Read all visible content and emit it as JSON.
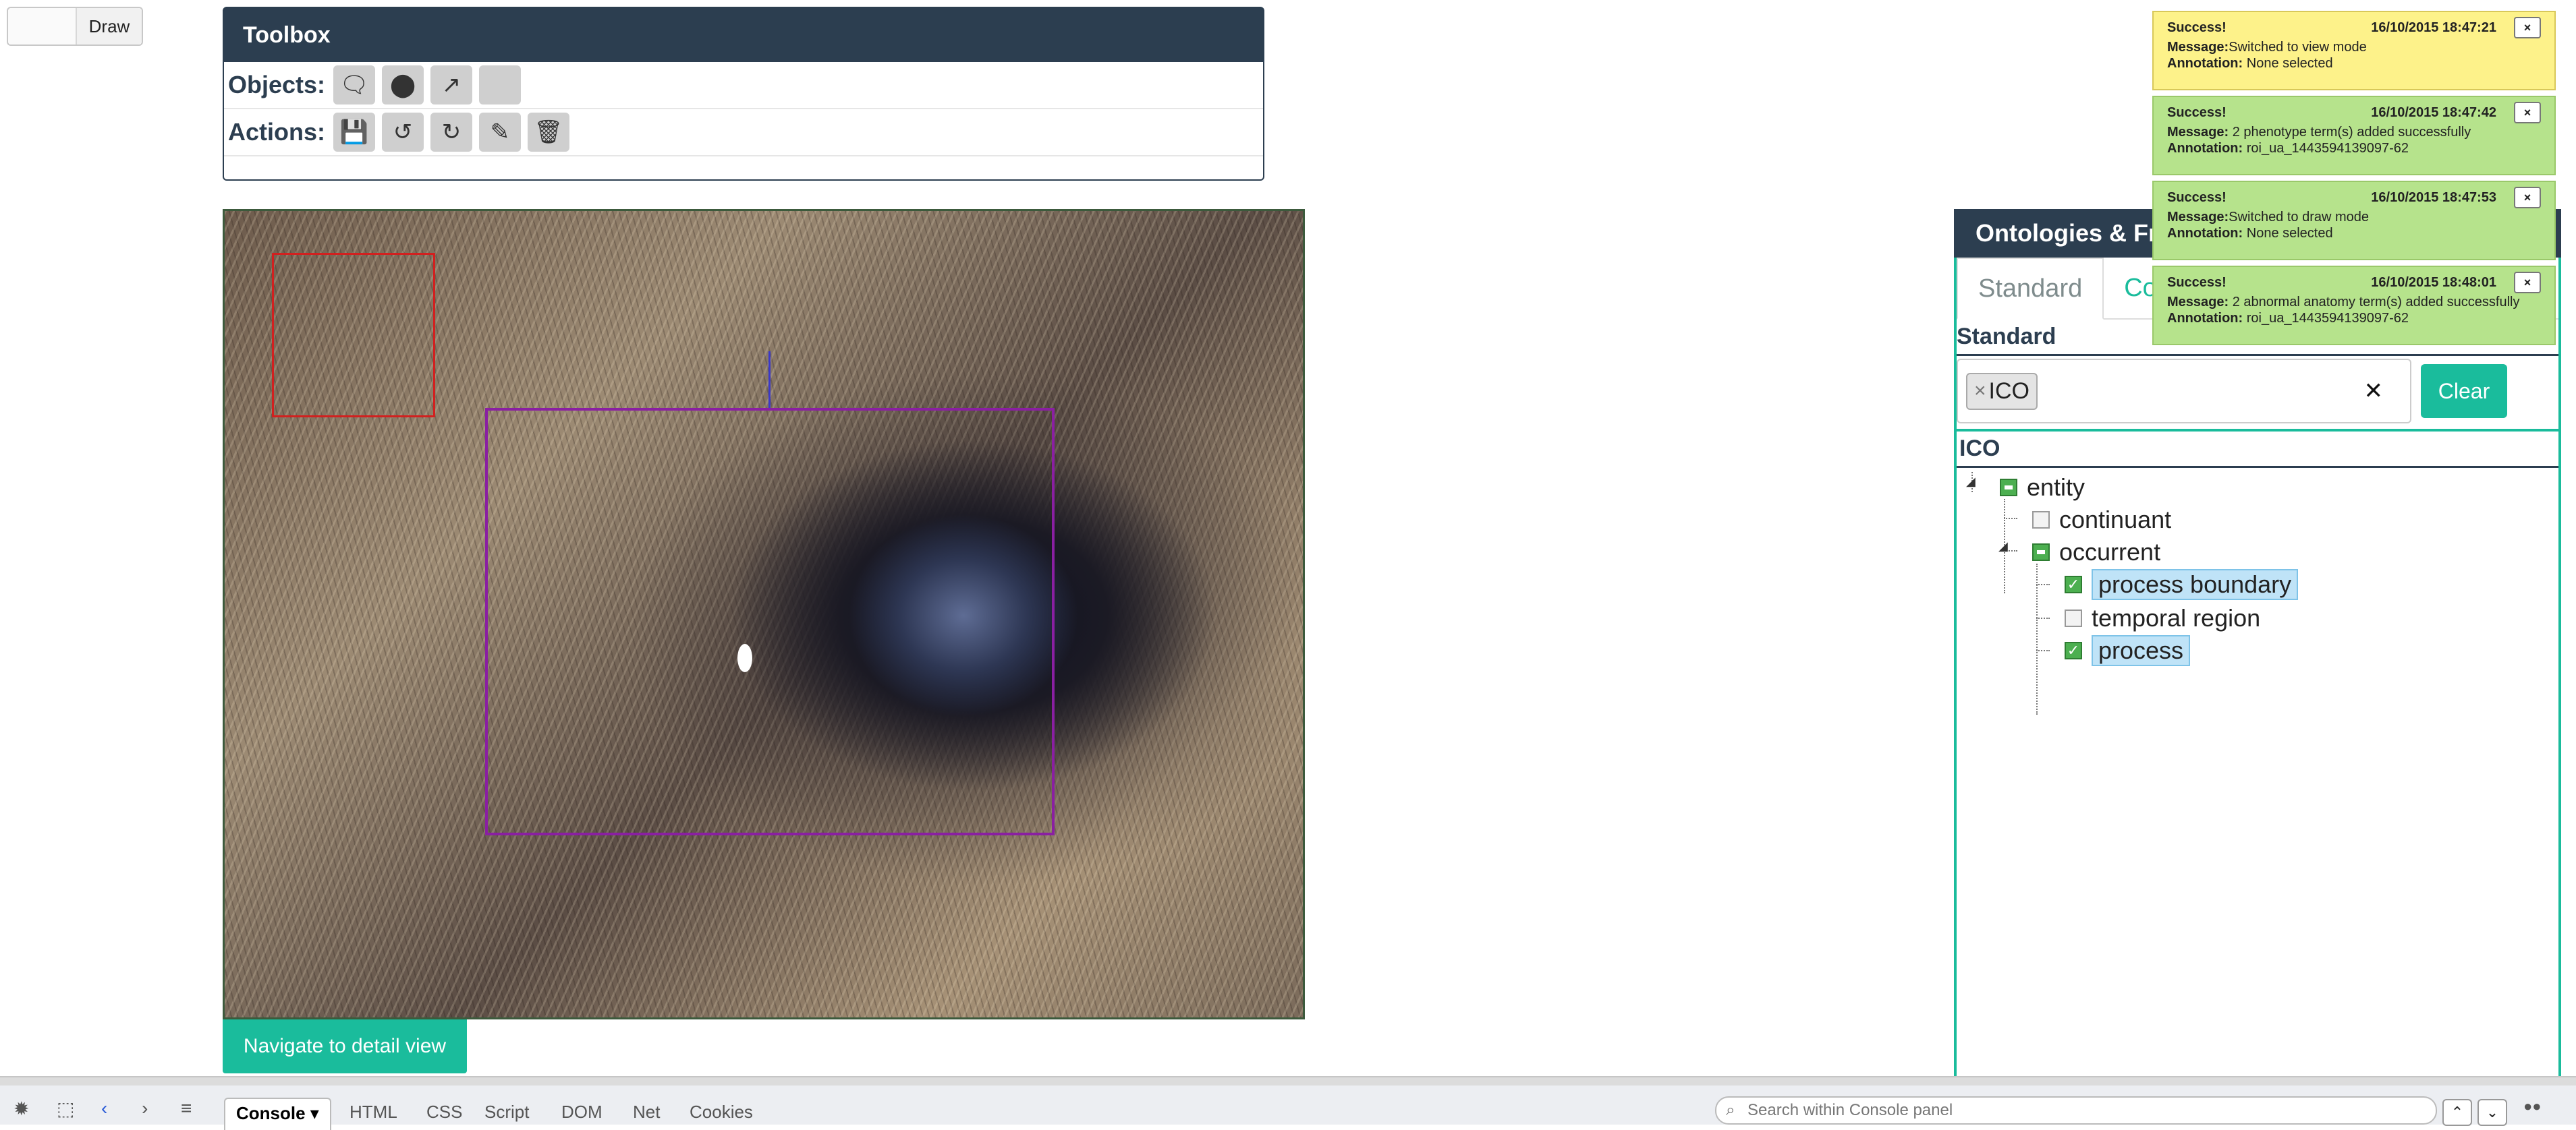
{
  "mode_toggle": {
    "label": "Draw"
  },
  "toolbox": {
    "title": "Toolbox",
    "objects_label": "Objects:",
    "actions_label": "Actions:",
    "object_tools": [
      "comment-icon",
      "marker-icon",
      "polyline-icon",
      "empty-tool"
    ],
    "action_tools": [
      "save-icon",
      "undo-icon",
      "redo-icon",
      "edit-icon",
      "delete-icon"
    ]
  },
  "image": {
    "navigate_label": "Navigate to detail view"
  },
  "ontology": {
    "title": "Ontologies & Fre",
    "tabs": [
      "Standard",
      "Co"
    ],
    "section": "Standard",
    "filter_chip": "ICO",
    "clear_label": "Clear",
    "tree_root": "ICO",
    "nodes": [
      {
        "label": "entity",
        "state": "partial"
      },
      {
        "label": "continuant",
        "state": "unchecked"
      },
      {
        "label": "occurrent",
        "state": "partial"
      },
      {
        "label": "process boundary",
        "state": "checked",
        "highlight": true
      },
      {
        "label": "temporal region",
        "state": "unchecked"
      },
      {
        "label": "process",
        "state": "checked",
        "highlight": true
      }
    ]
  },
  "notifications": [
    {
      "status": "Success!",
      "time": "16/10/2015 18:47:21",
      "message": "Switched to view mode",
      "annotation": "None selected",
      "color": "#fdf28a"
    },
    {
      "status": "Success!",
      "time": "16/10/2015 18:47:42",
      "message": "2 phenotype term(s) added successfully",
      "annotation": "roi_ua_1443594139097-62",
      "color": "#b6e38c"
    },
    {
      "status": "Success!",
      "time": "16/10/2015 18:47:53",
      "message": "Switched to draw mode",
      "annotation": "None selected",
      "color": "#b6e38c"
    },
    {
      "status": "Success!",
      "time": "16/10/2015 18:48:01",
      "message": "2 abnormal anatomy term(s) added successfully",
      "annotation": "roi_ua_1443594139097-62",
      "color": "#b6e38c"
    }
  ],
  "notification_labels": {
    "message": "Message:",
    "annotation": "Annotation:",
    "close": "×"
  },
  "devtools": {
    "tabs": [
      "Console",
      "HTML",
      "CSS",
      "Script",
      "DOM",
      "Net",
      "Cookies"
    ],
    "search_placeholder": "Search within Console panel"
  },
  "colors": {
    "accent": "#1abc9c",
    "header": "#2c3e50",
    "roi_red": "#d2201f",
    "roi_purple": "#8a1fa2"
  }
}
